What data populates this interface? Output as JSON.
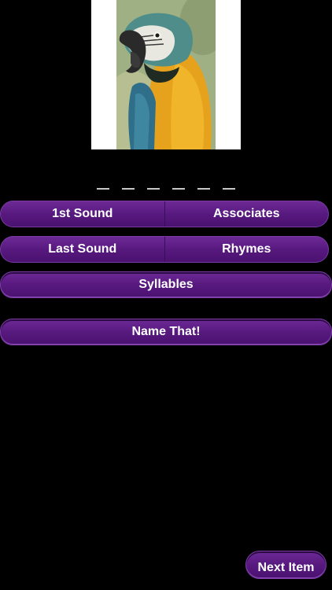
{
  "image": {
    "subject_icon": "parrot-photo"
  },
  "answer": {
    "blank_count": 6
  },
  "buttons": {
    "first_sound": "1st Sound",
    "associates": "Associates",
    "last_sound": "Last Sound",
    "rhymes": "Rhymes",
    "syllables": "Syllables",
    "name_that": "Name That!",
    "next_item": "Next Item"
  },
  "colors": {
    "background": "#000000",
    "button_purple": "#56187d",
    "button_border": "#7a3aa5",
    "text": "#ffffff"
  }
}
